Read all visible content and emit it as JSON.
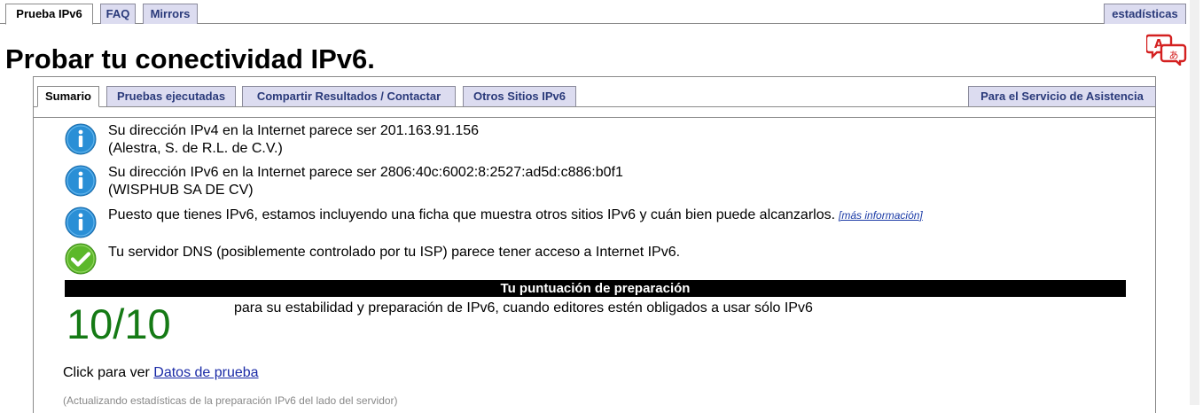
{
  "top_tabs": {
    "prueba": "Prueba IPv6",
    "faq": "FAQ",
    "mirrors": "Mirrors",
    "estadisticas": "estadísticas"
  },
  "page_title": "Probar tu conectividad IPv6.",
  "sub_tabs": {
    "sumario": "Sumario",
    "pruebas": "Pruebas ejecutadas",
    "compartir": "Compartir Resultados / Contactar",
    "otros": "Otros Sitios IPv6",
    "asistencia": "Para el Servicio de Asistencia"
  },
  "results": [
    {
      "icon": "info-icon",
      "line1": "Su dirección IPv4 en la Internet parece ser 201.163.91.156",
      "line2": "(Alestra, S. de R.L. de C.V.)"
    },
    {
      "icon": "info-icon",
      "line1": "Su dirección IPv6 en la Internet parece ser 2806:40c:6002:8:2527:ad5d:c886:b0f1",
      "line2": "(WISPHUB SA DE CV)"
    },
    {
      "icon": "info-icon",
      "line1": "Puesto que tienes IPv6, estamos incluyendo una ficha que muestra otros sitios IPv6 y cuán bien puede alcanzarlos.",
      "more": "[más información]"
    },
    {
      "icon": "check-icon",
      "line1": "Tu servidor DNS (posiblemente controlado por tu ISP) parece tener acceso a Internet IPv6."
    }
  ],
  "score": {
    "header": "Tu puntuación de preparación",
    "value": "10/10",
    "description": "para su estabilidad y preparación de IPv6, cuando editores estén obligados a usar sólo IPv6"
  },
  "click_line": {
    "prefix": "Click para ver",
    "link": "Datos de prueba"
  },
  "updating_text": "(Actualizando estadísticas de la preparación IPv6 del lado del servidor)",
  "colors": {
    "tab_bg": "#dcdcf0",
    "tab_text": "#2a3a7a",
    "score_green": "#157a15",
    "info_blue": "#2a8fd6",
    "check_green": "#5cb82a",
    "translate_red": "#d42020"
  }
}
